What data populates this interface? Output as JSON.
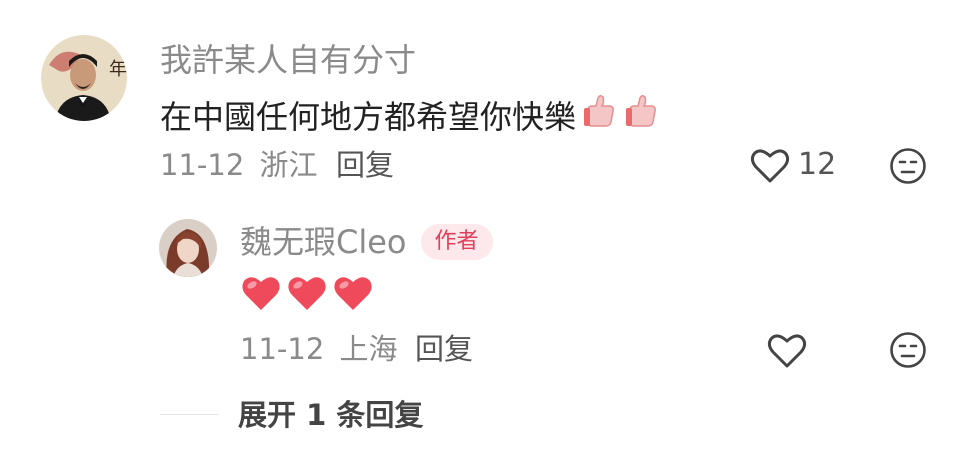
{
  "comment": {
    "username": "我許某人自有分寸",
    "text": "在中國任何地方都希望你快樂",
    "date": "11-12",
    "location": "浙江",
    "reply_label": "回复",
    "like_count": "12"
  },
  "reply": {
    "username": "魏无瑕Cleo",
    "badge": "作者",
    "date": "11-12",
    "location": "上海",
    "reply_label": "回复"
  },
  "expand": {
    "label": "展开 1 条回复"
  },
  "colors": {
    "badge_bg": "#fde9ec",
    "badge_text": "#e0405a",
    "heart_red": "#ef4a5c"
  }
}
